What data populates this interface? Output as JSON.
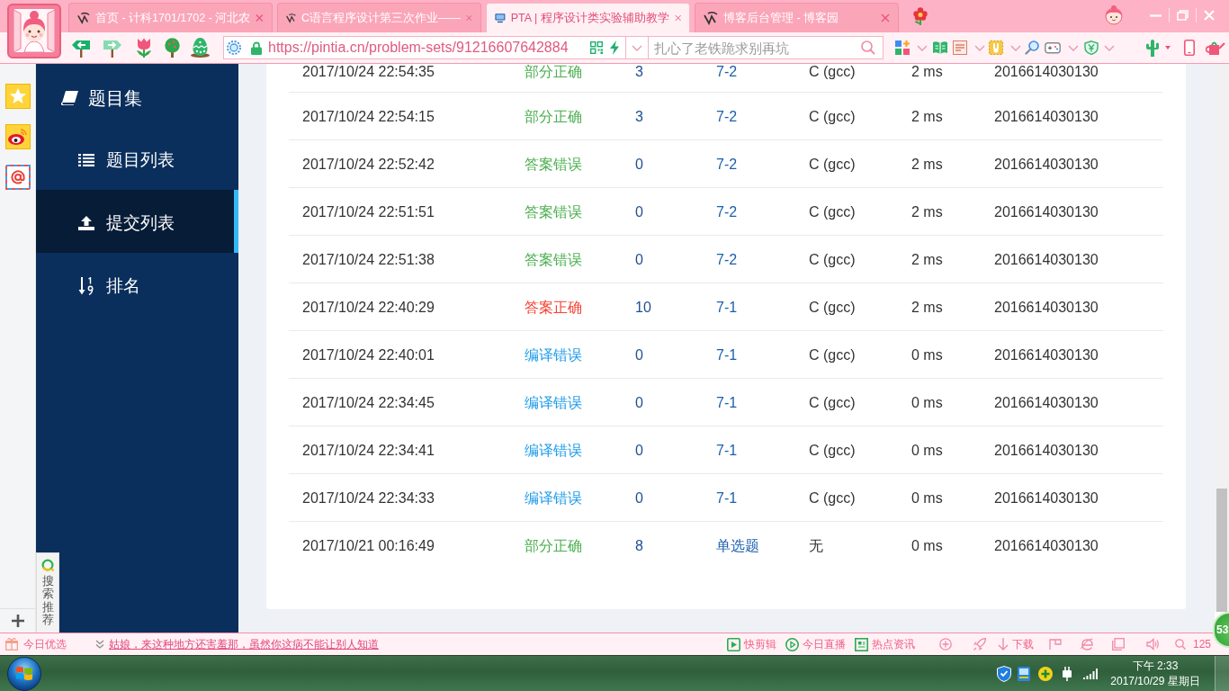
{
  "browser": {
    "tabs": [
      {
        "kind": "blog",
        "title": "首页 - 计科1701/1702 - 河北农",
        "selected": false
      },
      {
        "kind": "blog",
        "title": "C语言程序设计第三次作业——",
        "selected": false
      },
      {
        "kind": "pta",
        "title": "PTA | 程序设计类实验辅助教学",
        "selected": true
      },
      {
        "kind": "blog",
        "title": "博客后台管理 - 博客园",
        "selected": false
      }
    ],
    "address": "https://pintia.cn/problem-sets/91216607642884",
    "search": {
      "placeholder": "扎心了老铁跪求别再坑"
    }
  },
  "search_panel": {
    "label": "搜索推荐"
  },
  "sidebar": {
    "title": "题目集",
    "items": [
      {
        "kind": "list",
        "label": "题目列表",
        "selected": false
      },
      {
        "kind": "upload",
        "label": "提交列表",
        "selected": true
      },
      {
        "kind": "ranking",
        "label": "排名",
        "selected": false
      }
    ]
  },
  "submissions": {
    "rows": [
      {
        "time": "2017/10/24 22:54:35",
        "status": "部分正确",
        "color": "#4caf50",
        "score": "3",
        "problem": "7-2",
        "compiler": "C (gcc)",
        "duration": "2 ms",
        "user": "2016614030130"
      },
      {
        "time": "2017/10/24 22:54:15",
        "status": "部分正确",
        "color": "#4caf50",
        "score": "3",
        "problem": "7-2",
        "compiler": "C (gcc)",
        "duration": "2 ms",
        "user": "2016614030130"
      },
      {
        "time": "2017/10/24 22:52:42",
        "status": "答案错误",
        "color": "#4caf50",
        "score": "0",
        "problem": "7-2",
        "compiler": "C (gcc)",
        "duration": "2 ms",
        "user": "2016614030130"
      },
      {
        "time": "2017/10/24 22:51:51",
        "status": "答案错误",
        "color": "#4caf50",
        "score": "0",
        "problem": "7-2",
        "compiler": "C (gcc)",
        "duration": "2 ms",
        "user": "2016614030130"
      },
      {
        "time": "2017/10/24 22:51:38",
        "status": "答案错误",
        "color": "#4caf50",
        "score": "0",
        "problem": "7-2",
        "compiler": "C (gcc)",
        "duration": "2 ms",
        "user": "2016614030130"
      },
      {
        "time": "2017/10/24 22:40:29",
        "status": "答案正确",
        "color": "#f44336",
        "score": "10",
        "problem": "7-1",
        "compiler": "C (gcc)",
        "duration": "2 ms",
        "user": "2016614030130"
      },
      {
        "time": "2017/10/24 22:40:01",
        "status": "编译错误",
        "color": "#1e9be8",
        "score": "0",
        "problem": "7-1",
        "compiler": "C (gcc)",
        "duration": "0 ms",
        "user": "2016614030130"
      },
      {
        "time": "2017/10/24 22:34:45",
        "status": "编译错误",
        "color": "#1e9be8",
        "score": "0",
        "problem": "7-1",
        "compiler": "C (gcc)",
        "duration": "0 ms",
        "user": "2016614030130"
      },
      {
        "time": "2017/10/24 22:34:41",
        "status": "编译错误",
        "color": "#1e9be8",
        "score": "0",
        "problem": "7-1",
        "compiler": "C (gcc)",
        "duration": "0 ms",
        "user": "2016614030130"
      },
      {
        "time": "2017/10/24 22:34:33",
        "status": "编译错误",
        "color": "#1e9be8",
        "score": "0",
        "problem": "7-1",
        "compiler": "C (gcc)",
        "duration": "0 ms",
        "user": "2016614030130"
      },
      {
        "time": "2017/10/21 00:16:49",
        "status": "部分正确",
        "color": "#4caf50",
        "score": "8",
        "problem": "单选题",
        "compiler": "无",
        "duration": "0 ms",
        "user": "2016614030130"
      }
    ]
  },
  "status_bar": {
    "promo": "今日优选",
    "headline": "姑娘，来这种地方还害羞那，虽然你这病不能让别人知道",
    "tools": [
      {
        "kind": "clip",
        "label": "快剪辑"
      },
      {
        "kind": "live",
        "label": "今日直播"
      },
      {
        "kind": "news",
        "label": "热点资讯"
      }
    ],
    "download": "下载",
    "zoom": "125"
  },
  "speed_ball": {
    "value": "53"
  },
  "taskbar": {
    "time": "下午 2:33",
    "date": "2017/10/29 星期日"
  }
}
